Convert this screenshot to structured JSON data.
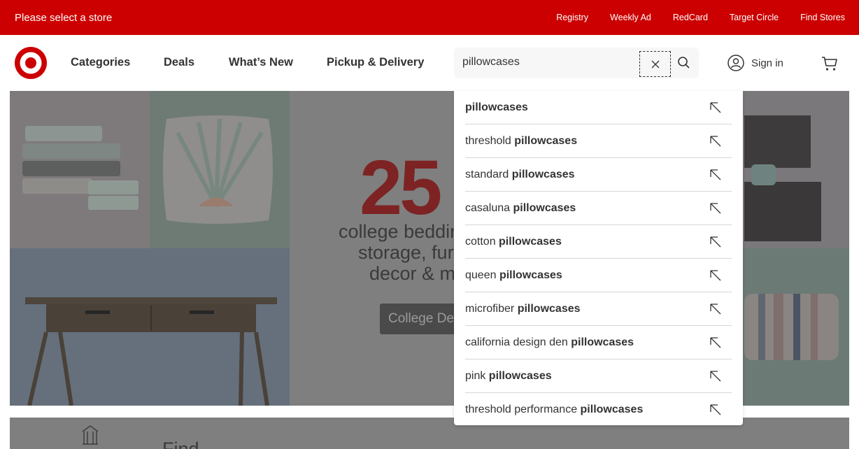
{
  "topbar": {
    "store_prompt": "Please select a store",
    "links": [
      "Registry",
      "Weekly Ad",
      "RedCard",
      "Target Circle",
      "Find Stores"
    ]
  },
  "header": {
    "logo_icon": "target-bullseye-icon",
    "nav": [
      "Categories",
      "Deals",
      "What’s New",
      "Pickup & Delivery"
    ],
    "search": {
      "value": "pillowcases"
    },
    "signin_label": "Sign in"
  },
  "hero": {
    "promo_number": "25",
    "lines": [
      "college beddin",
      "storage, furn",
      "decor & m"
    ],
    "button_label": "College De",
    "bottom_text": "Find"
  },
  "suggestions": [
    {
      "prefix": "",
      "term": "pillowcases"
    },
    {
      "prefix": "threshold ",
      "term": "pillowcases"
    },
    {
      "prefix": "standard ",
      "term": "pillowcases"
    },
    {
      "prefix": "casaluna ",
      "term": "pillowcases"
    },
    {
      "prefix": "cotton ",
      "term": "pillowcases"
    },
    {
      "prefix": "queen ",
      "term": "pillowcases"
    },
    {
      "prefix": "microfiber ",
      "term": "pillowcases"
    },
    {
      "prefix": "california design den ",
      "term": "pillowcases"
    },
    {
      "prefix": "pink ",
      "term": "pillowcases"
    },
    {
      "prefix": "threshold performance ",
      "term": "pillowcases"
    }
  ],
  "colors": {
    "brand_red": "#cc0000",
    "text": "#333333"
  }
}
